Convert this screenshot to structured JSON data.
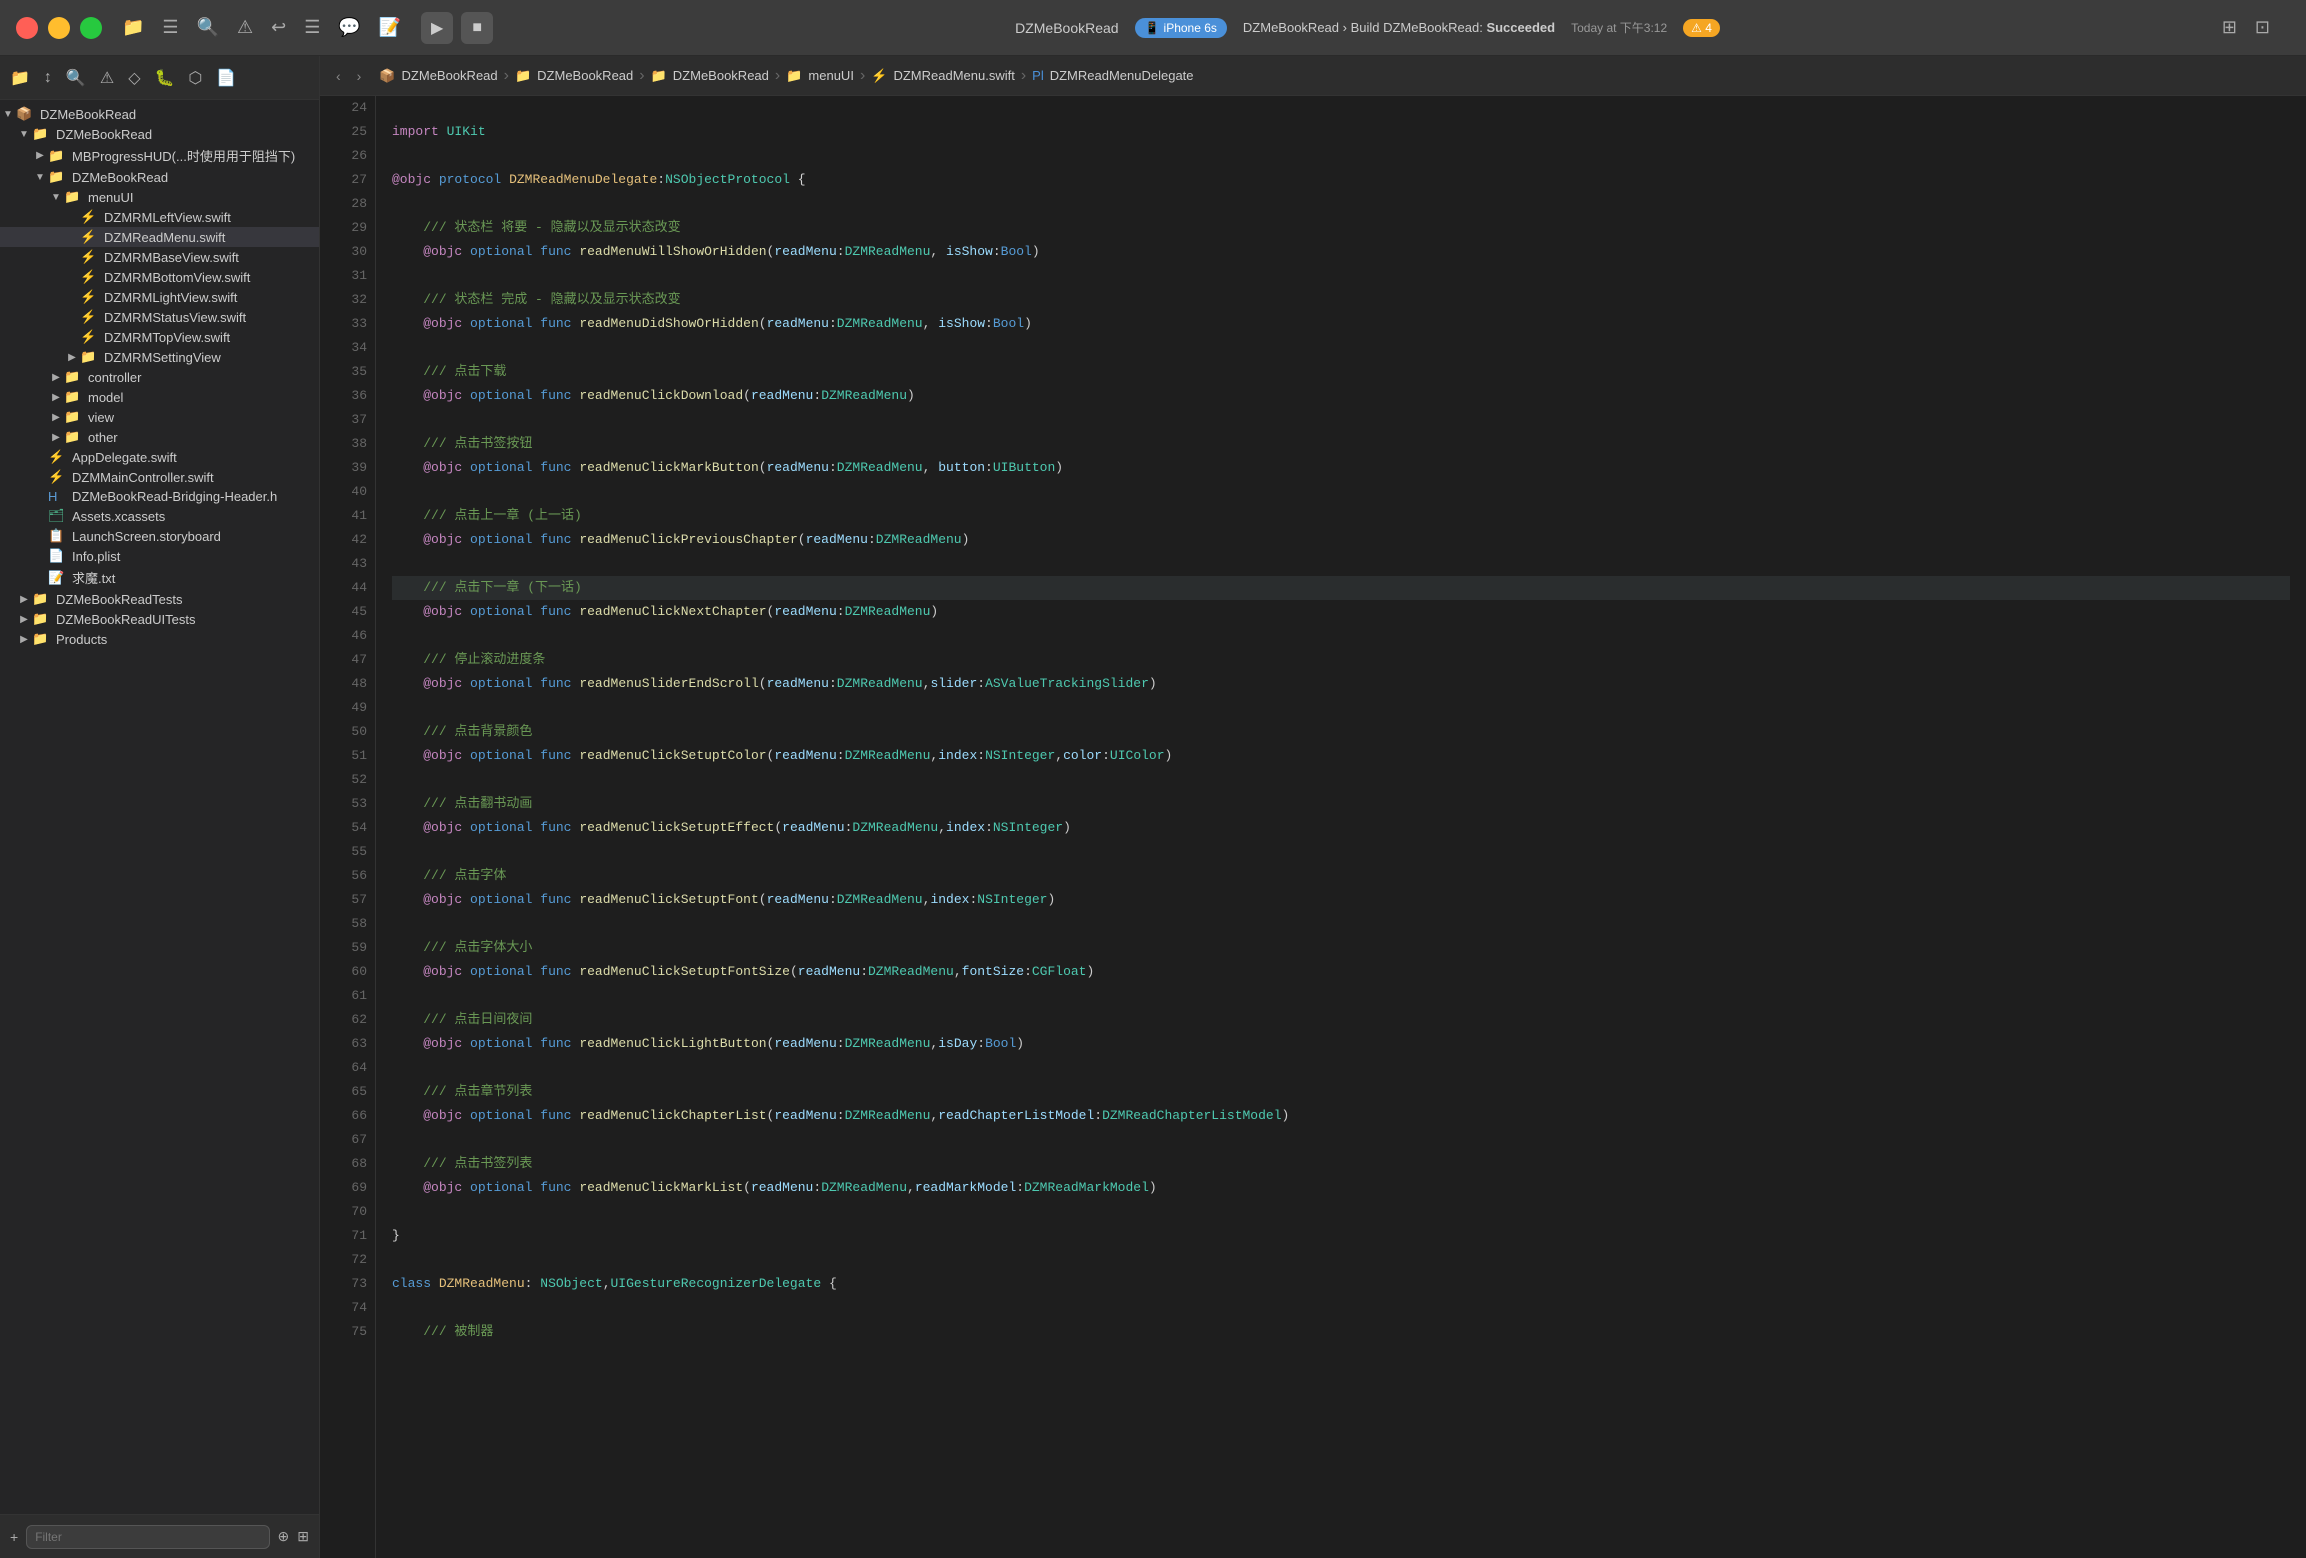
{
  "titleBar": {
    "appName": "DZMeBookRead",
    "device": "iPhone 6s",
    "buildLabel": "DZMeBookRead",
    "buildAction": "Build DZMeBookRead:",
    "buildStatus": "Succeeded",
    "timestamp": "Today at 下午3:12",
    "warningCount": "⚠ 4"
  },
  "breadcrumb": {
    "items": [
      {
        "label": "DZMeBookRead",
        "type": "project"
      },
      {
        "label": "DZMeBookRead",
        "type": "folder"
      },
      {
        "label": "DZMeBookRead",
        "type": "folder"
      },
      {
        "label": "menuUI",
        "type": "folder"
      },
      {
        "label": "DZMReadMenu.swift",
        "type": "swift"
      },
      {
        "label": "DZMReadMenuDelegate",
        "type": "delegate"
      }
    ]
  },
  "sidebar": {
    "filterPlaceholder": "Filter",
    "tree": [
      {
        "level": 0,
        "type": "project",
        "label": "DZMeBookRead",
        "expanded": true
      },
      {
        "level": 1,
        "type": "folder",
        "label": "DZMeBookRead",
        "expanded": true
      },
      {
        "level": 2,
        "type": "folder",
        "label": "MBProgressHUD(...时使用用于阻挡下)",
        "expanded": false
      },
      {
        "level": 2,
        "type": "folder",
        "label": "DZMeBookRead",
        "expanded": true
      },
      {
        "level": 3,
        "type": "folder",
        "label": "menuUI",
        "expanded": true
      },
      {
        "level": 4,
        "type": "swift",
        "label": "DZMRMLeftView.swift"
      },
      {
        "level": 4,
        "type": "swift",
        "label": "DZMReadMenu.swift",
        "active": true
      },
      {
        "level": 4,
        "type": "swift",
        "label": "DZMRMBaseView.swift"
      },
      {
        "level": 4,
        "type": "swift",
        "label": "DZMRMBottomView.swift"
      },
      {
        "level": 4,
        "type": "swift",
        "label": "DZMRMLightView.swift"
      },
      {
        "level": 4,
        "type": "swift",
        "label": "DZMRMStatusView.swift"
      },
      {
        "level": 4,
        "type": "swift",
        "label": "DZMRMTopView.swift"
      },
      {
        "level": 4,
        "type": "folder",
        "label": "DZMRMSettingView",
        "expanded": false
      },
      {
        "level": 3,
        "type": "folder",
        "label": "controller",
        "expanded": false
      },
      {
        "level": 3,
        "type": "folder",
        "label": "model",
        "expanded": false
      },
      {
        "level": 3,
        "type": "folder",
        "label": "view",
        "expanded": false
      },
      {
        "level": 3,
        "type": "folder",
        "label": "other",
        "expanded": false
      },
      {
        "level": 2,
        "type": "swift",
        "label": "AppDelegate.swift"
      },
      {
        "level": 2,
        "type": "swift",
        "label": "DZMMainController.swift"
      },
      {
        "level": 2,
        "type": "header",
        "label": "DZMeBookRead-Bridging-Header.h"
      },
      {
        "level": 2,
        "type": "xcassets",
        "label": "Assets.xcassets"
      },
      {
        "level": 2,
        "type": "storyboard",
        "label": "LaunchScreen.storyboard"
      },
      {
        "level": 2,
        "type": "plist",
        "label": "Info.plist"
      },
      {
        "level": 2,
        "type": "txt",
        "label": "求魔.txt"
      },
      {
        "level": 1,
        "type": "folder",
        "label": "DZMeBookReadTests",
        "expanded": false
      },
      {
        "level": 1,
        "type": "folder",
        "label": "DZMeBookReadUITests",
        "expanded": false
      },
      {
        "level": 1,
        "type": "folder",
        "label": "Products",
        "expanded": false
      }
    ]
  },
  "editor": {
    "lines": [
      {
        "num": 24,
        "content": ""
      },
      {
        "num": 25,
        "content": "import UIKit",
        "highlight": false
      },
      {
        "num": 26,
        "content": ""
      },
      {
        "num": 27,
        "content": "@objc protocol DZMReadMenuDelegate:NSObjectProtocol {",
        "highlight": false
      },
      {
        "num": 28,
        "content": ""
      },
      {
        "num": 29,
        "content": "    /// 状态栏 将要 - 隐藏以及显示状态改变",
        "highlight": false
      },
      {
        "num": 30,
        "content": "    @objc optional func readMenuWillShowOrHidden(readMenu:DZMReadMenu, isShow:Bool)",
        "highlight": false
      },
      {
        "num": 31,
        "content": ""
      },
      {
        "num": 32,
        "content": "    /// 状态栏 完成 - 隐藏以及显示状态改变",
        "highlight": false
      },
      {
        "num": 33,
        "content": "    @objc optional func readMenuDidShowOrHidden(readMenu:DZMReadMenu, isShow:Bool)",
        "highlight": false
      },
      {
        "num": 34,
        "content": ""
      },
      {
        "num": 35,
        "content": "    /// 点击下载",
        "highlight": false
      },
      {
        "num": 36,
        "content": "    @objc optional func readMenuClickDownload(readMenu:DZMReadMenu)",
        "highlight": false
      },
      {
        "num": 37,
        "content": ""
      },
      {
        "num": 38,
        "content": "    /// 点击书签按钮",
        "highlight": false
      },
      {
        "num": 39,
        "content": "    @objc optional func readMenuClickMarkButton(readMenu:DZMReadMenu, button:UIButton)",
        "highlight": false
      },
      {
        "num": 40,
        "content": ""
      },
      {
        "num": 41,
        "content": "    /// 点击上一章 (上一话)",
        "highlight": false
      },
      {
        "num": 42,
        "content": "    @objc optional func readMenuClickPreviousChapter(readMenu:DZMReadMenu)",
        "highlight": false
      },
      {
        "num": 43,
        "content": ""
      },
      {
        "num": 44,
        "content": "    /// 点击下一章 (下一话)",
        "highlight": true
      },
      {
        "num": 45,
        "content": "    @objc optional func readMenuClickNextChapter(readMenu:DZMReadMenu)",
        "highlight": false
      },
      {
        "num": 46,
        "content": ""
      },
      {
        "num": 47,
        "content": "    /// 停止滚动进度条",
        "highlight": false
      },
      {
        "num": 48,
        "content": "    @objc optional func readMenuSliderEndScroll(readMenu:DZMReadMenu,slider:ASValueTrackingSlider)",
        "highlight": false
      },
      {
        "num": 49,
        "content": ""
      },
      {
        "num": 50,
        "content": "    /// 点击背景颜色",
        "highlight": false
      },
      {
        "num": 51,
        "content": "    @objc optional func readMenuClickSetuptColor(readMenu:DZMReadMenu,index:NSInteger,color:UIColor)",
        "highlight": false
      },
      {
        "num": 52,
        "content": ""
      },
      {
        "num": 53,
        "content": "    /// 点击翻书动画",
        "highlight": false
      },
      {
        "num": 54,
        "content": "    @objc optional func readMenuClickSetuptEffect(readMenu:DZMReadMenu,index:NSInteger)",
        "highlight": false
      },
      {
        "num": 55,
        "content": ""
      },
      {
        "num": 56,
        "content": "    /// 点击字体",
        "highlight": false
      },
      {
        "num": 57,
        "content": "    @objc optional func readMenuClickSetuptFont(readMenu:DZMReadMenu,index:NSInteger)",
        "highlight": false
      },
      {
        "num": 58,
        "content": ""
      },
      {
        "num": 59,
        "content": "    /// 点击字体大小",
        "highlight": false
      },
      {
        "num": 60,
        "content": "    @objc optional func readMenuClickSetuptFontSize(readMenu:DZMReadMenu,fontSize:CGFloat)",
        "highlight": false
      },
      {
        "num": 61,
        "content": ""
      },
      {
        "num": 62,
        "content": "    /// 点击日间夜间",
        "highlight": false
      },
      {
        "num": 63,
        "content": "    @objc optional func readMenuClickLightButton(readMenu:DZMReadMenu,isDay:Bool)",
        "highlight": false
      },
      {
        "num": 64,
        "content": ""
      },
      {
        "num": 65,
        "content": "    /// 点击章节列表",
        "highlight": false
      },
      {
        "num": 66,
        "content": "    @objc optional func readMenuClickChapterList(readMenu:DZMReadMenu,readChapterListModel:DZMReadChapterListModel)",
        "highlight": false
      },
      {
        "num": 67,
        "content": ""
      },
      {
        "num": 68,
        "content": "    /// 点击书签列表",
        "highlight": false
      },
      {
        "num": 69,
        "content": "    @objc optional func readMenuClickMarkList(readMenu:DZMReadMenu,readMarkModel:DZMReadMarkModel)",
        "highlight": false
      },
      {
        "num": 70,
        "content": ""
      },
      {
        "num": 71,
        "content": "}",
        "highlight": false
      },
      {
        "num": 72,
        "content": ""
      },
      {
        "num": 73,
        "content": "class DZMReadMenu: NSObject,UIGestureRecognizerDelegate {",
        "highlight": false
      },
      {
        "num": 74,
        "content": ""
      },
      {
        "num": 75,
        "content": "    /// 被制器",
        "highlight": false
      }
    ]
  }
}
